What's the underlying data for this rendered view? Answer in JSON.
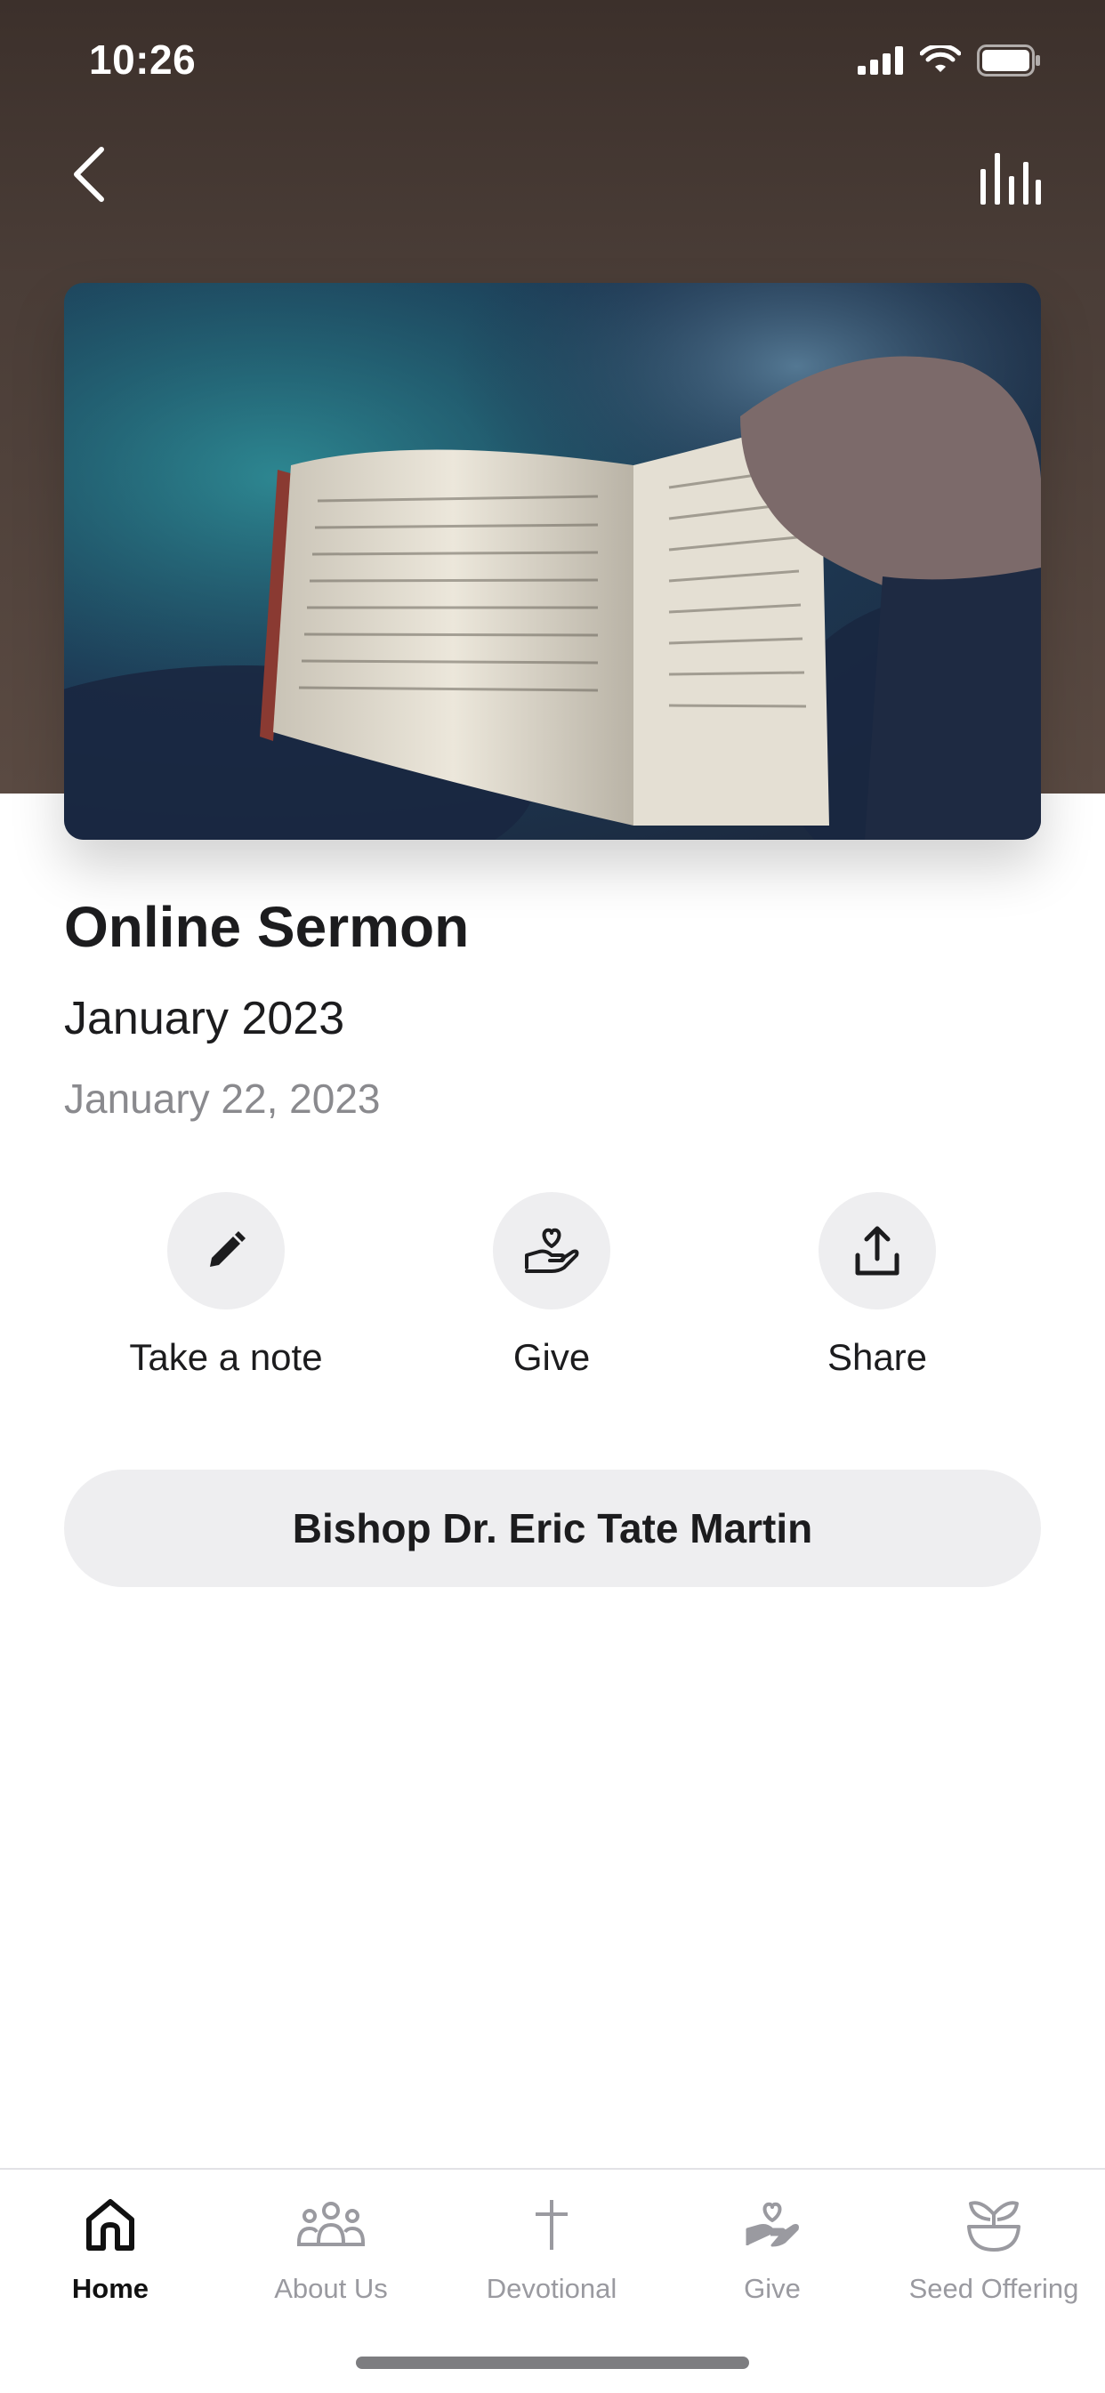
{
  "status_bar": {
    "time": "10:26"
  },
  "header": {
    "back_icon": "chevron-left-icon",
    "audio_icon": "audio-bars-icon"
  },
  "sermon": {
    "title": "Online Sermon",
    "series": "January 2023",
    "date": "January 22, 2023"
  },
  "actions": [
    {
      "label": "Take a note",
      "icon": "pencil-icon"
    },
    {
      "label": "Give",
      "icon": "hand-heart-icon"
    },
    {
      "label": "Share",
      "icon": "share-icon"
    }
  ],
  "speaker": {
    "name": "Bishop Dr. Eric Tate Martin"
  },
  "tabbar": {
    "items": [
      {
        "label": "Home",
        "icon": "home-icon",
        "active": true
      },
      {
        "label": "About Us",
        "icon": "people-icon",
        "active": false
      },
      {
        "label": "Devotional",
        "icon": "cross-icon",
        "active": false
      },
      {
        "label": "Give",
        "icon": "hand-heart-icon",
        "active": false
      },
      {
        "label": "Seed Offering",
        "icon": "plant-icon",
        "active": false
      }
    ]
  },
  "colors": {
    "header_bg": "#4a3d37",
    "pill_bg": "#eeeef0",
    "active_tab": "#111111",
    "inactive_tab": "#9a9aa0"
  }
}
